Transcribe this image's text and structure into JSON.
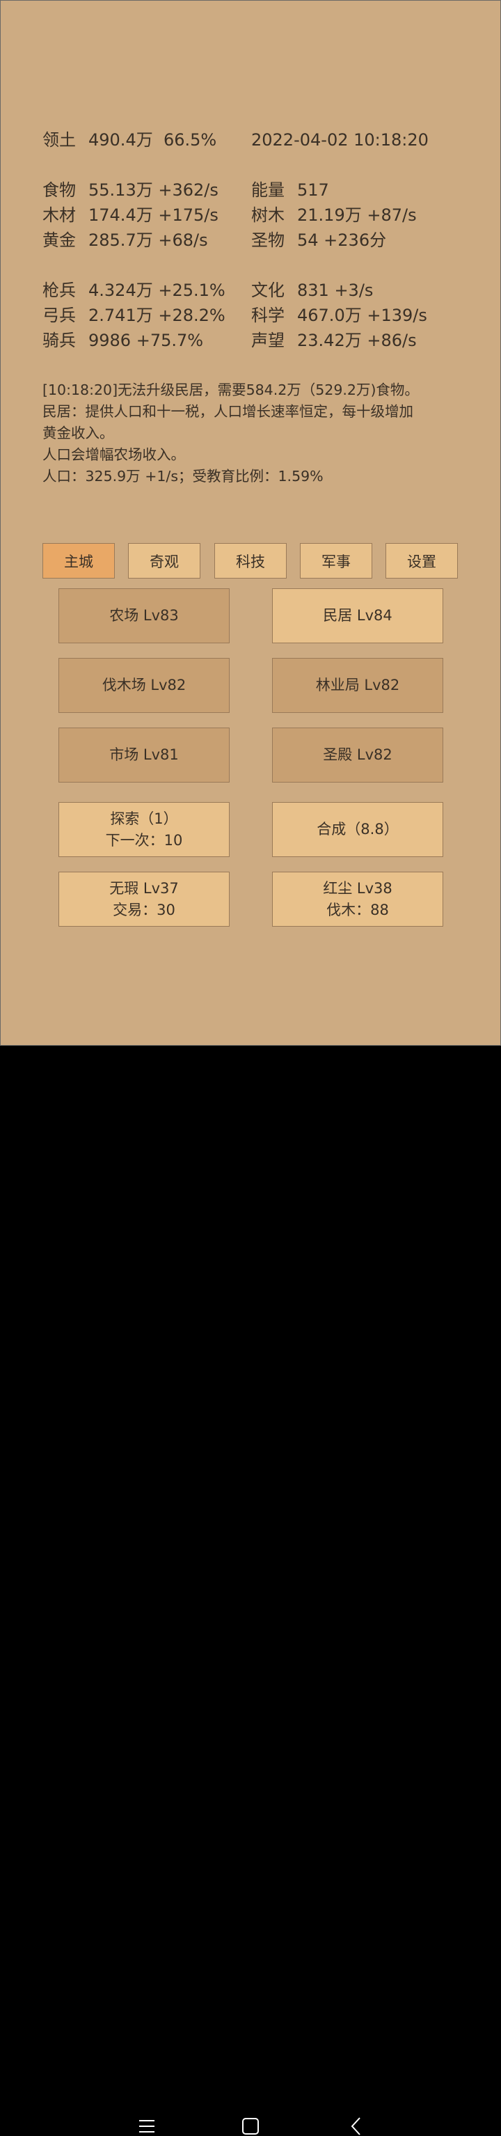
{
  "stats": {
    "territory": {
      "label": "领土",
      "value": "490.4万  66.5%"
    },
    "datetime": "2022-04-02 10:18:20",
    "left": [
      {
        "label": "食物",
        "value": "55.13万 +362/s"
      },
      {
        "label": "木材",
        "value": "174.4万 +175/s"
      },
      {
        "label": "黄金",
        "value": "285.7万 +68/s"
      },
      {
        "label": "枪兵",
        "value": "4.324万 +25.1%"
      },
      {
        "label": "弓兵",
        "value": "2.741万 +28.2%"
      },
      {
        "label": "骑兵",
        "value": "9986 +75.7%"
      }
    ],
    "right": [
      {
        "label": "能量",
        "value": "517"
      },
      {
        "label": "树木",
        "value": "21.19万 +87/s"
      },
      {
        "label": "圣物",
        "value": "54 +236分"
      },
      {
        "label": "文化",
        "value": "831 +3/s"
      },
      {
        "label": "科学",
        "value": "467.0万 +139/s"
      },
      {
        "label": "声望",
        "value": "23.42万 +86/s"
      }
    ]
  },
  "message": [
    "[10:18:20]无法升级民居，需要584.2万（529.2万)食物。",
    "民居：提供人口和十一税，人口增长速率恒定，每十级增加",
    "黄金收入。",
    "人口会增幅农场收入。",
    "人口：325.9万 +1/s；受教育比例：1.59%"
  ],
  "tabs": [
    "主城",
    "奇观",
    "科技",
    "军事",
    "设置"
  ],
  "active_tab": "主城",
  "buildings": [
    {
      "label": "农场 Lv83"
    },
    {
      "label": "民居 Lv84"
    },
    {
      "label": "伐木场 Lv82"
    },
    {
      "label": "林业局 Lv82"
    },
    {
      "label": "市场 Lv81"
    },
    {
      "label": "圣殿 Lv82"
    }
  ],
  "actions": [
    {
      "line1": "探索（1）",
      "line2": "下一次：10"
    },
    {
      "line1": "合成（8.8）",
      "line2": ""
    },
    {
      "line1": "无瑕 Lv37",
      "line2": "交易：30"
    },
    {
      "line1": "红尘 Lv38",
      "line2": "伐木：88"
    }
  ],
  "colors": {
    "background": "#cdab82",
    "button_light": "#e8c18b",
    "button_dark": "#c8a072",
    "tab_active": "#e9a866"
  },
  "icons": [
    "menu-icon",
    "home-square-icon",
    "back-chevron-icon"
  ]
}
